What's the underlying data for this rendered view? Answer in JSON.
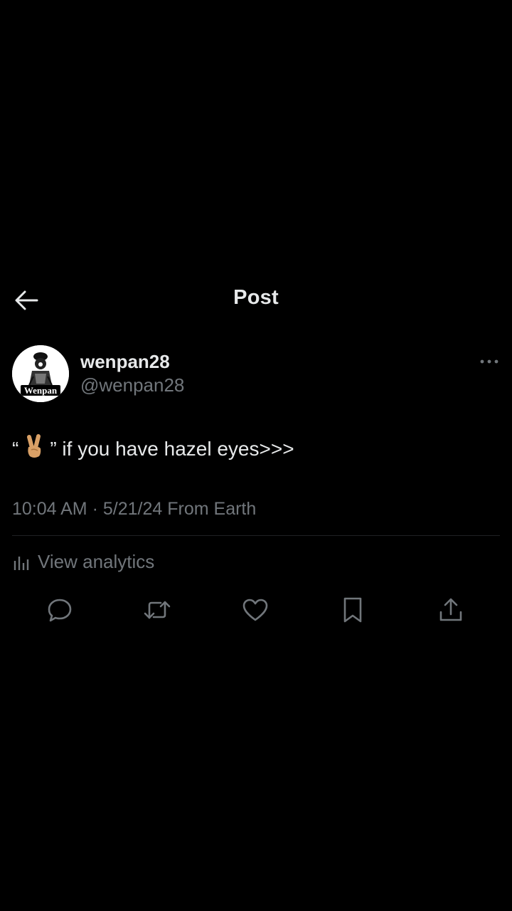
{
  "header": {
    "title": "Post"
  },
  "post": {
    "display_name": "wenpan28",
    "handle": "@wenpan28",
    "avatar_text": "Wenpan",
    "text_prefix": "“",
    "text_emoji": "✌️",
    "text_suffix": "” if you have hazel eyes>>>",
    "time": "10:04 AM",
    "separator": "·",
    "date": "5/21/24",
    "source": "From Earth"
  },
  "analytics": {
    "label": "View analytics"
  },
  "actions": [
    "reply-icon",
    "repost-icon",
    "like-icon",
    "bookmark-icon",
    "share-icon"
  ],
  "colors": {
    "background": "#000000",
    "primary_text": "#e7e9ea",
    "secondary_text": "#71767b",
    "divider": "#1f2124"
  }
}
